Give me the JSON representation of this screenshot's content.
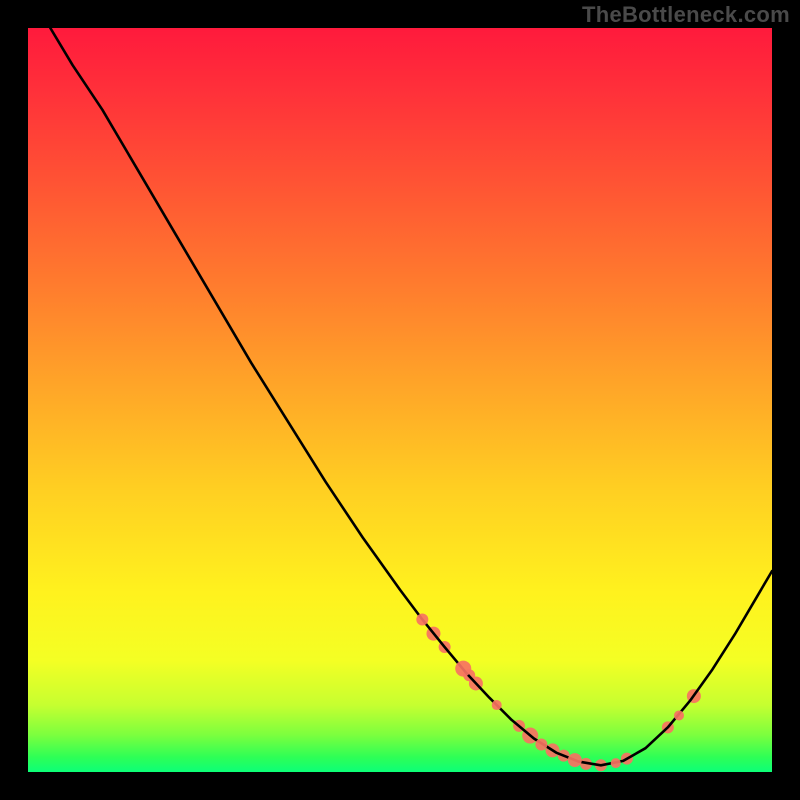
{
  "watermark": "TheBottleneck.com",
  "chart_data": {
    "type": "line",
    "title": "",
    "xlabel": "",
    "ylabel": "",
    "xlim": [
      0,
      100
    ],
    "ylim": [
      0,
      100
    ],
    "grid": false,
    "legend": false,
    "background": "vertical-gradient red→yellow→green",
    "curve": {
      "description": "Asymmetric V-shaped black curve; steep descent from top-left, minimum near x≈70, shallower rise toward right edge ending near y≈27.",
      "x": [
        3,
        6,
        10,
        15,
        20,
        25,
        30,
        35,
        40,
        45,
        50,
        53,
        56,
        59,
        62,
        65,
        68,
        71,
        74,
        77,
        80,
        83,
        86,
        89,
        92,
        95,
        98,
        100
      ],
      "y": [
        100,
        95,
        89,
        80.5,
        72,
        63.5,
        55,
        47,
        39,
        31.5,
        24.5,
        20.5,
        16.8,
        13.2,
        10,
        7,
        4.5,
        2.6,
        1.4,
        0.9,
        1.5,
        3.2,
        6,
        9.6,
        13.8,
        18.5,
        23.6,
        27
      ]
    },
    "markers": {
      "description": "Salmon dots on the curve clustered on descending side ~x 53–60, around the trough ~x 63–80, and on ascending side ~x 86–90.",
      "color": "#f77262",
      "points": [
        {
          "x": 53.0,
          "y": 20.5,
          "r": 6
        },
        {
          "x": 54.5,
          "y": 18.6,
          "r": 7
        },
        {
          "x": 56.0,
          "y": 16.8,
          "r": 6
        },
        {
          "x": 58.5,
          "y": 13.9,
          "r": 8
        },
        {
          "x": 59.3,
          "y": 13.0,
          "r": 6
        },
        {
          "x": 60.2,
          "y": 11.9,
          "r": 7
        },
        {
          "x": 63.0,
          "y": 9.0,
          "r": 5
        },
        {
          "x": 66.0,
          "y": 6.2,
          "r": 6
        },
        {
          "x": 67.5,
          "y": 4.9,
          "r": 8
        },
        {
          "x": 69.0,
          "y": 3.7,
          "r": 6
        },
        {
          "x": 70.5,
          "y": 2.9,
          "r": 7
        },
        {
          "x": 72.0,
          "y": 2.2,
          "r": 6
        },
        {
          "x": 73.5,
          "y": 1.6,
          "r": 7
        },
        {
          "x": 75.0,
          "y": 1.1,
          "r": 6
        },
        {
          "x": 77.0,
          "y": 0.9,
          "r": 6
        },
        {
          "x": 79.0,
          "y": 1.2,
          "r": 5
        },
        {
          "x": 80.5,
          "y": 1.8,
          "r": 6
        },
        {
          "x": 86.0,
          "y": 6.0,
          "r": 6
        },
        {
          "x": 87.5,
          "y": 7.6,
          "r": 5
        },
        {
          "x": 89.5,
          "y": 10.2,
          "r": 7
        }
      ]
    }
  }
}
